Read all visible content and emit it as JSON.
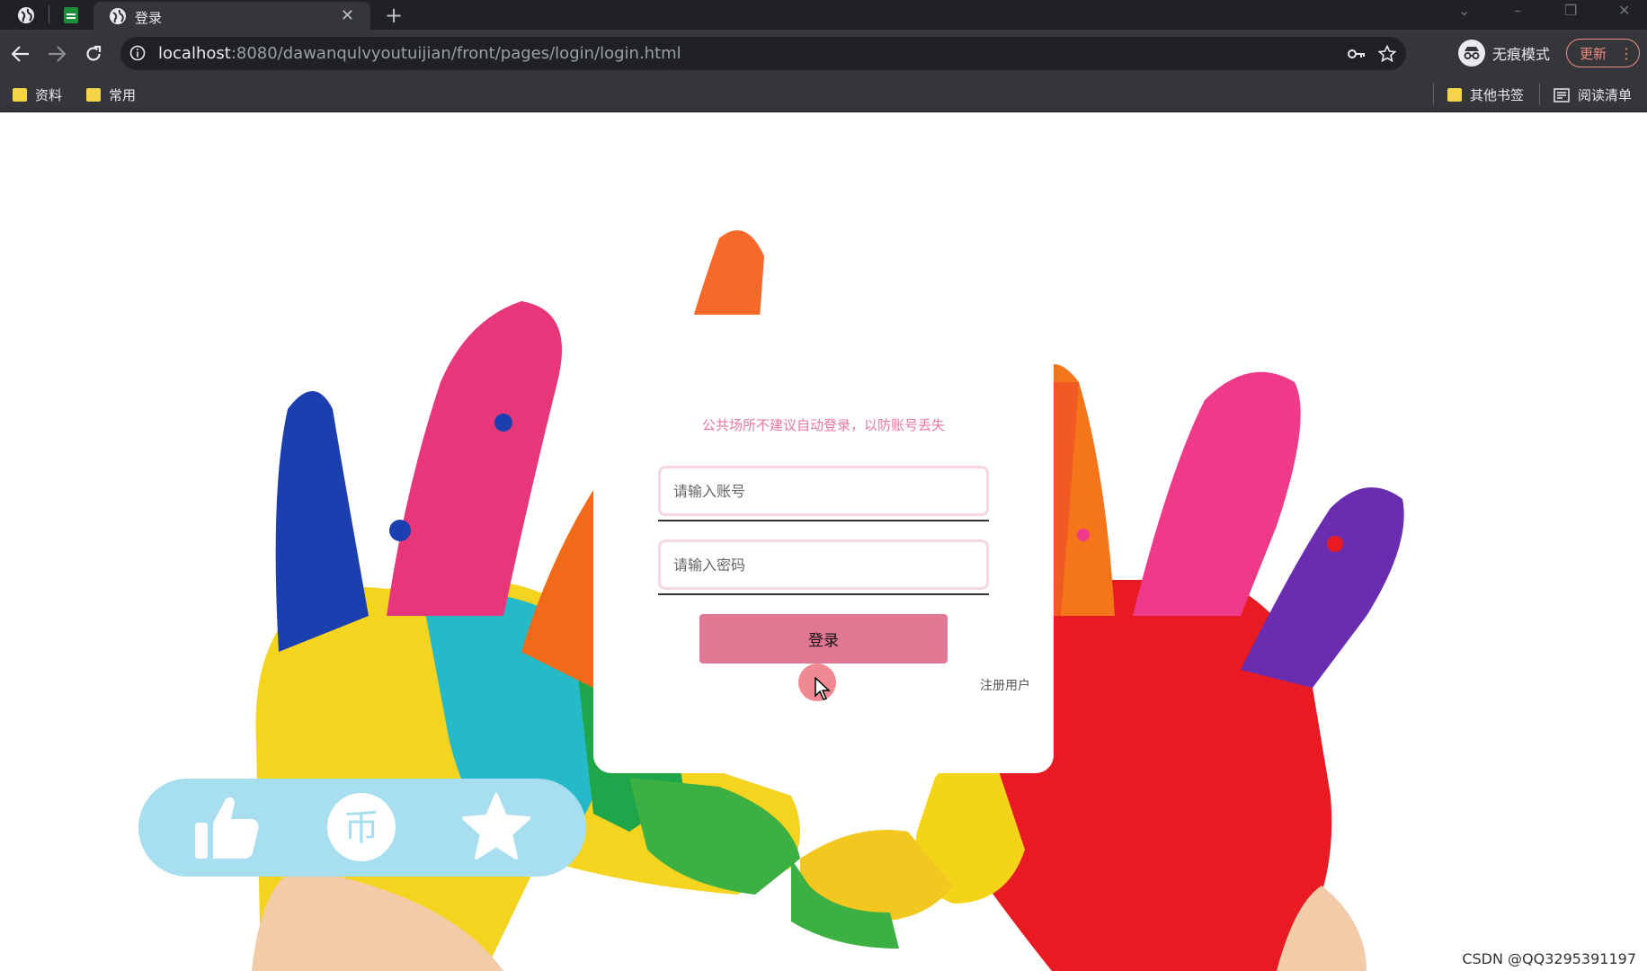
{
  "browser": {
    "tab_title": "登录",
    "url_host": "localhost",
    "url_rest": ":8080/dawanqulvyoutuijian/front/pages/login/login.html",
    "incognito_label": "无痕模式",
    "update_label": "更新",
    "bookmarks": [
      "资料",
      "常用"
    ],
    "bookmarks_right": [
      "其他书签",
      "阅读清单"
    ]
  },
  "login": {
    "notice": "公共场所不建议自动登录，以防账号丢失",
    "account_placeholder": "请输入账号",
    "password_placeholder": "请输入密码",
    "login_button": "登录",
    "register_link": "注册用户"
  },
  "actions": {
    "like_icon": "thumbs-up-icon",
    "coin_icon": "coin-icon",
    "coin_glyph": "币",
    "favorite_icon": "star-icon"
  },
  "watermark": "CSDN @QQ3295391197",
  "colors": {
    "accent_pink": "#e07793",
    "notice_pink": "#e8789a",
    "pill_blue": "#a7dff0"
  }
}
